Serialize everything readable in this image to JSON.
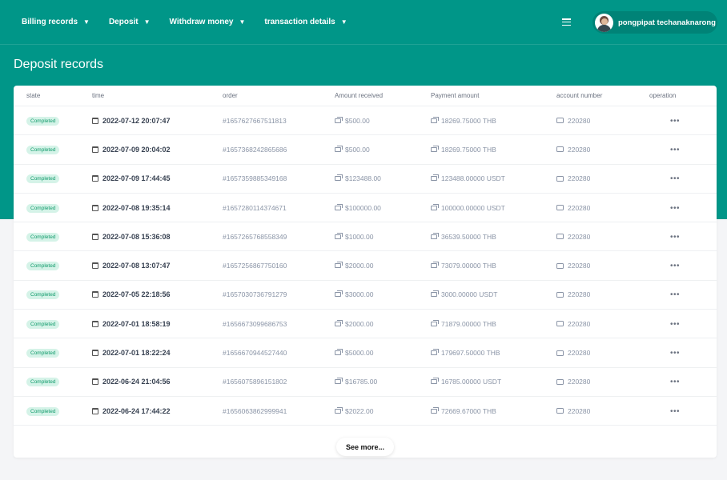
{
  "nav": {
    "items": [
      {
        "label": "Billing records"
      },
      {
        "label": "Deposit"
      },
      {
        "label": "Withdraw money"
      },
      {
        "label": "transaction details"
      }
    ]
  },
  "user": {
    "name": "pongpipat techanaknarong"
  },
  "page": {
    "title": "Deposit records"
  },
  "table": {
    "headers": {
      "state": "state",
      "time": "time",
      "order": "order",
      "amount": "Amount received",
      "payment": "Payment amount",
      "account": "account number",
      "operation": "operation"
    },
    "rows": [
      {
        "state": "Completed",
        "time": "2022-07-12 20:07:47",
        "order": "#1657627667511813",
        "amount": "$500.00",
        "payment": "18269.75000 THB",
        "account": "220280"
      },
      {
        "state": "Completed",
        "time": "2022-07-09 20:04:02",
        "order": "#1657368242865686",
        "amount": "$500.00",
        "payment": "18269.75000 THB",
        "account": "220280"
      },
      {
        "state": "Completed",
        "time": "2022-07-09 17:44:45",
        "order": "#1657359885349168",
        "amount": "$123488.00",
        "payment": "123488.00000 USDT",
        "account": "220280"
      },
      {
        "state": "Completed",
        "time": "2022-07-08 19:35:14",
        "order": "#1657280114374671",
        "amount": "$100000.00",
        "payment": "100000.00000 USDT",
        "account": "220280"
      },
      {
        "state": "Completed",
        "time": "2022-07-08 15:36:08",
        "order": "#1657265768558349",
        "amount": "$1000.00",
        "payment": "36539.50000 THB",
        "account": "220280"
      },
      {
        "state": "Completed",
        "time": "2022-07-08 13:07:47",
        "order": "#1657256867750160",
        "amount": "$2000.00",
        "payment": "73079.00000 THB",
        "account": "220280"
      },
      {
        "state": "Completed",
        "time": "2022-07-05 22:18:56",
        "order": "#1657030736791279",
        "amount": "$3000.00",
        "payment": "3000.00000 USDT",
        "account": "220280"
      },
      {
        "state": "Completed",
        "time": "2022-07-01 18:58:19",
        "order": "#1656673099686753",
        "amount": "$2000.00",
        "payment": "71879.00000 THB",
        "account": "220280"
      },
      {
        "state": "Completed",
        "time": "2022-07-01 18:22:24",
        "order": "#1656670944527440",
        "amount": "$5000.00",
        "payment": "179697.50000 THB",
        "account": "220280"
      },
      {
        "state": "Completed",
        "time": "2022-06-24 21:04:56",
        "order": "#1656075896151802",
        "amount": "$16785.00",
        "payment": "16785.00000 USDT",
        "account": "220280"
      },
      {
        "state": "Completed",
        "time": "2022-06-24 17:44:22",
        "order": "#1656063862999941",
        "amount": "$2022.00",
        "payment": "72669.67000 THB",
        "account": "220280"
      }
    ]
  },
  "see_more": {
    "label": "See more..."
  },
  "colors": {
    "header_bg": "#009688",
    "badge_bg": "#d5f3e8",
    "badge_text": "#0f9a6a"
  }
}
